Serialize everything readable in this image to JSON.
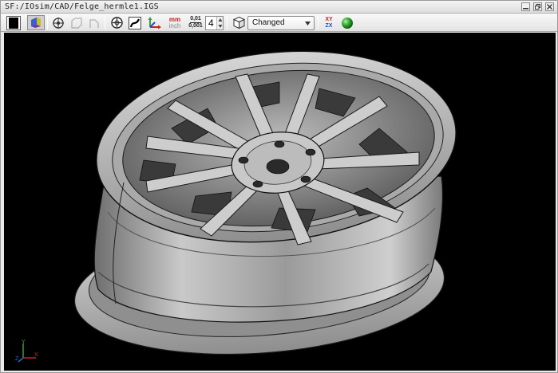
{
  "window": {
    "title": "SF:/IOsim/CAD/Felge_hermle1.IGS"
  },
  "toolbar": {
    "units": {
      "metric": "mm",
      "imperial": "inch"
    },
    "precision": {
      "coarse": "0,01",
      "fine": "0,001"
    },
    "decimal_places": "4",
    "display_mode": "Changed",
    "view_axes_top": "XY",
    "view_axes_bottom": "ZX"
  },
  "viewport": {
    "model": "wheel-rim",
    "background": "#000000",
    "triad_labels": {
      "x": "X",
      "y": "Y",
      "z": "Z"
    }
  },
  "colors": {
    "accent_red": "#c62020",
    "status_green": "#2fa62f",
    "model_gray": "#bdbdbd"
  }
}
